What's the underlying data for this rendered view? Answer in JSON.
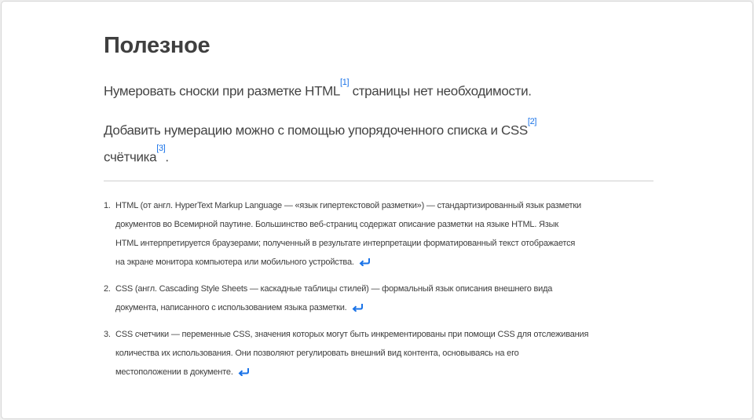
{
  "title": "Полезное",
  "paragraphs": {
    "p1_before": "Нумеровать сноски при разметке HTML",
    "p1_ref": "[1]",
    "p1_after": " страницы нет необходимости.",
    "p2_before": "Добавить нумерацию можно с помощью упорядоченного списка и CSS",
    "p2_ref": "[2]",
    "p2_line2": "счётчика",
    "p2_ref2": "[3]",
    "p2_end": "."
  },
  "footnotes": [
    {
      "num": "1.",
      "lines": [
        "HTML (от англ. HyperText Markup Language — «язык гипертекстовой разметки») — стандартизированный язык разметки",
        "документов во Всемирной паутине. Большинство веб-страниц содержат описание разметки на языке HTML. Язык",
        "HTML интерпретируется браузерами; полученный в результате интерпретации форматированный текст отображается",
        "на экране монитора компьютера или мобильного устройства."
      ],
      "icon": "return-arrow-icon"
    },
    {
      "num": "2.",
      "lines": [
        "CSS (англ. Cascading Style Sheets — каскадные таблицы стилей) — формальный язык описания внешнего вида",
        "документа, написанного с использованием языка разметки."
      ],
      "icon": "return-arrow-icon"
    },
    {
      "num": "3.",
      "lines": [
        "CSS счетчики — переменные CSS, значения которых могут быть инкрементированы при помощи CSS для отслеживания",
        "количества их использования. Они позволяют регулировать внешний вид контента, основываясь на его",
        "местоположении в документе."
      ],
      "icon": "return-arrow-icon"
    }
  ],
  "colors": {
    "link": "#1a73e8",
    "text": "#444444"
  }
}
